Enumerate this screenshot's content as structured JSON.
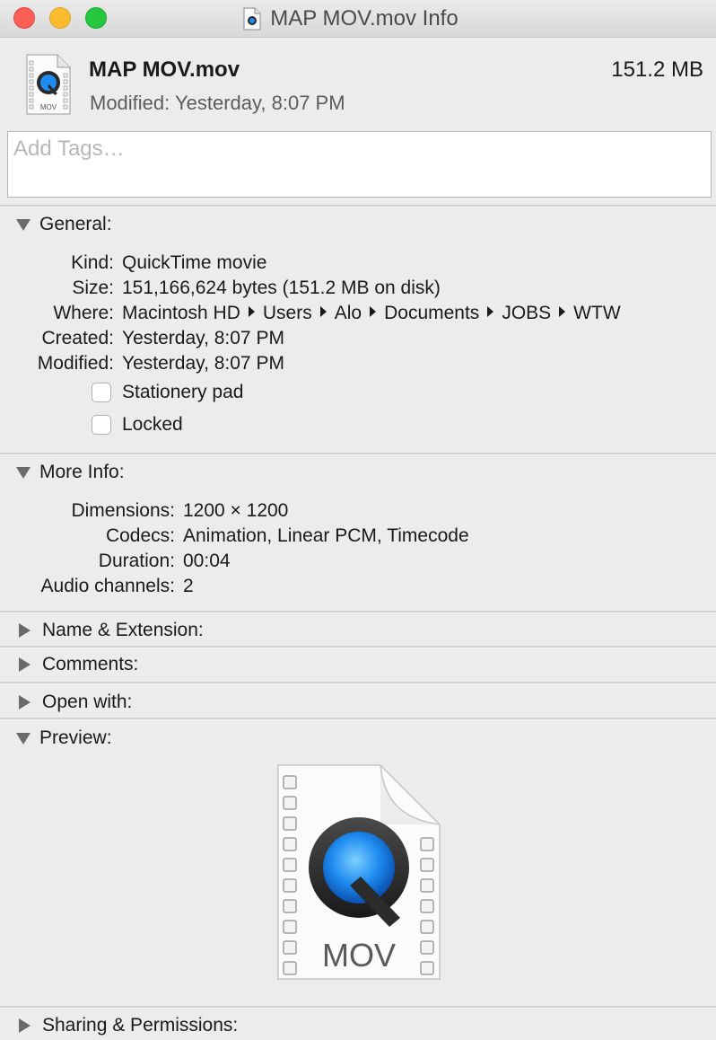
{
  "window": {
    "title": "MAP MOV.mov Info"
  },
  "header": {
    "file_name": "MAP MOV.mov",
    "file_size": "151.2 MB",
    "modified": "Modified: Yesterday, 8:07 PM",
    "icon_label": "MOV"
  },
  "tags": {
    "placeholder": "Add Tags…",
    "value": ""
  },
  "general": {
    "title": "General:",
    "kind_label": "Kind:",
    "kind_value": "QuickTime movie",
    "size_label": "Size:",
    "size_value": "151,166,624 bytes (151.2 MB on disk)",
    "where_label": "Where:",
    "where_path": [
      "Macintosh HD",
      "Users",
      "Alo",
      "Documents",
      "JOBS",
      "WTW"
    ],
    "created_label": "Created:",
    "created_value": "Yesterday, 8:07 PM",
    "modified_label": "Modified:",
    "modified_value": "Yesterday, 8:07 PM",
    "stationery_label": "Stationery pad",
    "stationery_checked": false,
    "locked_label": "Locked",
    "locked_checked": false
  },
  "more_info": {
    "title": "More Info:",
    "dimensions_label": "Dimensions:",
    "dimensions_value": "1200 × 1200",
    "codecs_label": "Codecs:",
    "codecs_value": "Animation, Linear PCM, Timecode",
    "duration_label": "Duration:",
    "duration_value": "00:04",
    "audio_label": "Audio channels:",
    "audio_value": "2"
  },
  "sections": {
    "name_extension": "Name & Extension:",
    "comments": "Comments:",
    "open_with": "Open with:",
    "preview": "Preview:",
    "sharing": "Sharing & Permissions:"
  },
  "preview": {
    "icon_label": "MOV"
  },
  "colors": {
    "background": "#ececec",
    "quicktime_blue": "#1e8cf0",
    "close": "#fd5e56",
    "minimize": "#fdbc2e",
    "maximize": "#27c840"
  }
}
